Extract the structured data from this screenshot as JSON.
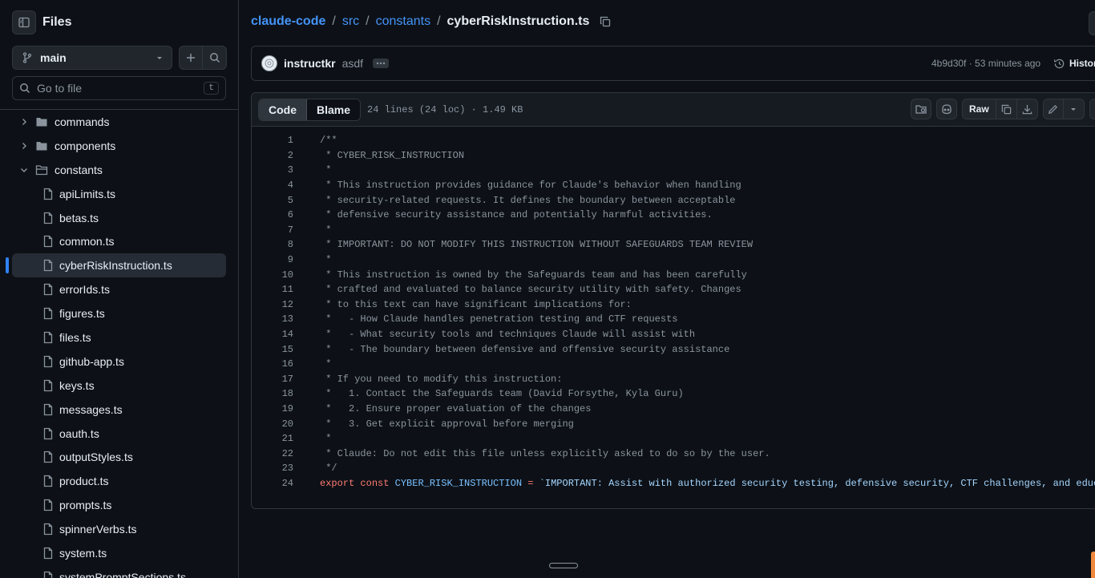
{
  "sidebar": {
    "title": "Files",
    "branch": "main",
    "goto_placeholder": "Go to file",
    "goto_shortcut": "t",
    "tree": [
      {
        "type": "folder",
        "label": "commands",
        "expanded": false
      },
      {
        "type": "folder",
        "label": "components",
        "expanded": false
      },
      {
        "type": "folder",
        "label": "constants",
        "expanded": true
      },
      {
        "type": "file",
        "label": "apiLimits.ts"
      },
      {
        "type": "file",
        "label": "betas.ts"
      },
      {
        "type": "file",
        "label": "common.ts"
      },
      {
        "type": "file",
        "label": "cyberRiskInstruction.ts",
        "selected": true
      },
      {
        "type": "file",
        "label": "errorIds.ts"
      },
      {
        "type": "file",
        "label": "figures.ts"
      },
      {
        "type": "file",
        "label": "files.ts"
      },
      {
        "type": "file",
        "label": "github-app.ts"
      },
      {
        "type": "file",
        "label": "keys.ts"
      },
      {
        "type": "file",
        "label": "messages.ts"
      },
      {
        "type": "file",
        "label": "oauth.ts"
      },
      {
        "type": "file",
        "label": "outputStyles.ts"
      },
      {
        "type": "file",
        "label": "product.ts"
      },
      {
        "type": "file",
        "label": "prompts.ts"
      },
      {
        "type": "file",
        "label": "spinnerVerbs.ts"
      },
      {
        "type": "file",
        "label": "system.ts"
      },
      {
        "type": "file",
        "label": "systemPromptSections.ts"
      }
    ]
  },
  "breadcrumb": {
    "repo": "claude-code",
    "dir1": "src",
    "dir2": "constants",
    "file": "cyberRiskInstruction.ts",
    "separator": "/"
  },
  "commit": {
    "author": "instructkr",
    "message": "asdf",
    "meta": "4b9d30f · 53 minutes ago",
    "history_label": "History"
  },
  "viewer": {
    "tab_code": "Code",
    "tab_blame": "Blame",
    "file_info": "24 lines (24 loc) · 1.49 KB",
    "raw_label": "Raw"
  },
  "code_lines": [
    {
      "n": "1",
      "text": "/**"
    },
    {
      "n": "2",
      "text": " * CYBER_RISK_INSTRUCTION"
    },
    {
      "n": "3",
      "text": " *"
    },
    {
      "n": "4",
      "text": " * This instruction provides guidance for Claude's behavior when handling"
    },
    {
      "n": "5",
      "text": " * security-related requests. It defines the boundary between acceptable"
    },
    {
      "n": "6",
      "text": " * defensive security assistance and potentially harmful activities."
    },
    {
      "n": "7",
      "text": " *"
    },
    {
      "n": "8",
      "text": " * IMPORTANT: DO NOT MODIFY THIS INSTRUCTION WITHOUT SAFEGUARDS TEAM REVIEW"
    },
    {
      "n": "9",
      "text": " *"
    },
    {
      "n": "10",
      "text": " * This instruction is owned by the Safeguards team and has been carefully"
    },
    {
      "n": "11",
      "text": " * crafted and evaluated to balance security utility with safety. Changes"
    },
    {
      "n": "12",
      "text": " * to this text can have significant implications for:"
    },
    {
      "n": "13",
      "text": " *   - How Claude handles penetration testing and CTF requests"
    },
    {
      "n": "14",
      "text": " *   - What security tools and techniques Claude will assist with"
    },
    {
      "n": "15",
      "text": " *   - The boundary between defensive and offensive security assistance"
    },
    {
      "n": "16",
      "text": " *"
    },
    {
      "n": "17",
      "text": " * If you need to modify this instruction:"
    },
    {
      "n": "18",
      "text": " *   1. Contact the Safeguards team (David Forsythe, Kyla Guru)"
    },
    {
      "n": "19",
      "text": " *   2. Ensure proper evaluation of the changes"
    },
    {
      "n": "20",
      "text": " *   3. Get explicit approval before merging"
    },
    {
      "n": "21",
      "text": " *"
    },
    {
      "n": "22",
      "text": " * Claude: Do not edit this file unless explicitly asked to do so by the user."
    },
    {
      "n": "23",
      "text": " */"
    }
  ],
  "last_line": {
    "n": "24",
    "keyword1": "export",
    "keyword2": "const",
    "name": "CYBER_RISK_INSTRUCTION",
    "op": "=",
    "string": "`IMPORTANT: Assist with authorized security testing, defensive security, CTF challenges, and educational c"
  },
  "colors": {
    "background": "#0d1117",
    "border": "#30363d",
    "link": "#4493f8",
    "keyword": "#ff7b72",
    "constant": "#79c0ff",
    "string": "#a5d6ff",
    "selection_marker": "#2f81f7"
  },
  "icons": {
    "panel": "sidebar-toggle-icon",
    "branch": "git-branch-icon",
    "add": "plus-icon",
    "search": "search-icon",
    "copy": "copy-icon",
    "history": "history-icon",
    "folder": "folder-icon",
    "file": "file-icon"
  }
}
